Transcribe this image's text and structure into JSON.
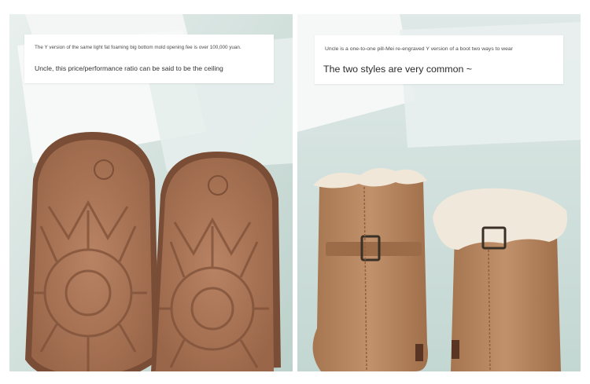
{
  "left_panel": {
    "caption_small": "The Y version of the same light fat foaming big bottom mold opening fee is over 100,000 yuan.",
    "caption_large": "Uncle, this price/performance ratio can be said to be the ceiling"
  },
  "right_panel": {
    "caption_small": "Uncle is a one-to-one pill-Mei re-engraved Y version of a boot two ways to wear",
    "caption_large": "The two styles are very common ~"
  },
  "colors": {
    "background": "#cfe0dc",
    "sole": "#b07a5a",
    "sole_dark": "#8f5e42",
    "suede": "#b98a62",
    "fur": "#efe6d8"
  }
}
